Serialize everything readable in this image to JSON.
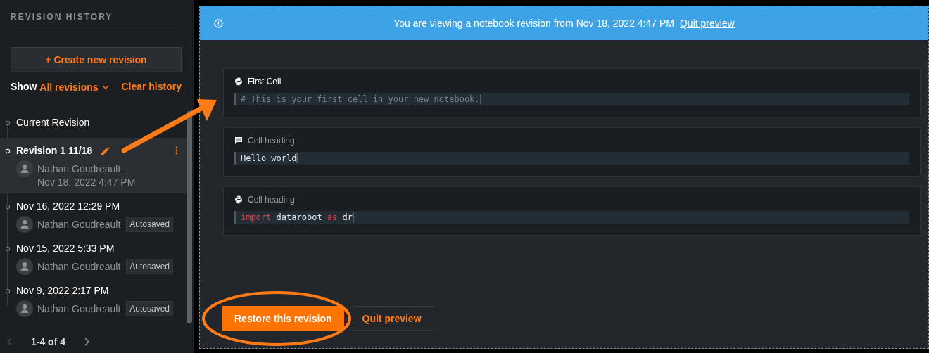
{
  "sidebar": {
    "title": "REVISION HISTORY",
    "create_button": "+ Create new revision",
    "show_label": "Show",
    "filter": "All revisions",
    "clear_link": "Clear history",
    "revisions": [
      {
        "kind": "current",
        "title": "Current Revision",
        "selected": false
      },
      {
        "kind": "named",
        "title": "Revision 1 11/18",
        "author": "Nathan Goudreault",
        "date": "Nov 18, 2022 4:47 PM",
        "selected": true
      },
      {
        "kind": "auto",
        "title": "Nov 16, 2022 12:29 PM",
        "author": "Nathan Goudreault",
        "badge": "Autosaved",
        "selected": false
      },
      {
        "kind": "auto",
        "title": "Nov 15, 2022 5:33 PM",
        "author": "Nathan Goudreault",
        "badge": "Autosaved",
        "selected": false
      },
      {
        "kind": "auto",
        "title": "Nov 9, 2022 2:17 PM",
        "author": "Nathan Goudreault",
        "badge": "Autosaved",
        "selected": false
      }
    ],
    "pagination": {
      "label": "1-4 of 4",
      "prev_disabled": true,
      "next_disabled": false
    }
  },
  "banner": {
    "message": "You are viewing a notebook revision from Nov 18, 2022 4:47 PM",
    "link": "Quit preview"
  },
  "cells": [
    {
      "kind": "code",
      "heading": "First Cell",
      "heading_placeholder": false,
      "tokens": [
        {
          "kind": "comment",
          "text": "# This is your first cell in your new notebook."
        }
      ]
    },
    {
      "kind": "markdown",
      "heading": "Cell heading",
      "heading_placeholder": true,
      "tokens": [
        {
          "kind": "plain",
          "text": "Hello world"
        }
      ]
    },
    {
      "kind": "code",
      "heading": "Cell heading",
      "heading_placeholder": true,
      "tokens": [
        {
          "kind": "keyword",
          "text": "import"
        },
        {
          "kind": "plain",
          "text": " datarobot "
        },
        {
          "kind": "keyword",
          "text": "as"
        },
        {
          "kind": "plain",
          "text": " dr"
        }
      ]
    }
  ],
  "actions": [
    {
      "kind": "primary",
      "label": "Restore this revision"
    },
    {
      "kind": "secondary",
      "label": "Quit preview"
    }
  ],
  "annotations": {
    "arrow": true,
    "ellipse": true
  }
}
